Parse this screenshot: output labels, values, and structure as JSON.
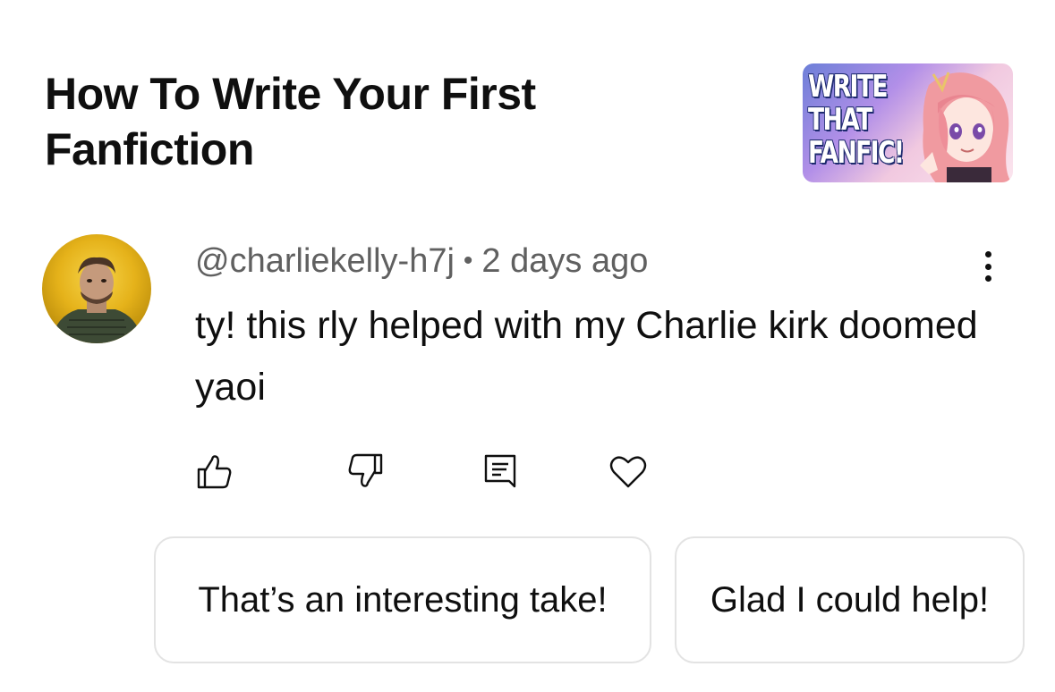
{
  "video": {
    "title": "How To Write Your First Fanfiction",
    "thumbnail_text": [
      "WRITE",
      "THAT",
      "FANFIC!"
    ]
  },
  "comment": {
    "author": "@charliekelly-h7j",
    "separator": "•",
    "time": "2 days ago",
    "text": "ty! this rly helped with my Charlie kirk doomed yaoi"
  },
  "actions": {
    "like_icon": "thumbs-up-icon",
    "dislike_icon": "thumbs-down-icon",
    "reply_icon": "comment-icon",
    "heart_icon": "heart-icon"
  },
  "suggested_replies": [
    "That’s an interesting take!",
    "Glad I could help!"
  ],
  "colors": {
    "text_primary": "#0f0f0f",
    "text_secondary": "#606060",
    "chip_border": "#e3e3e3"
  }
}
